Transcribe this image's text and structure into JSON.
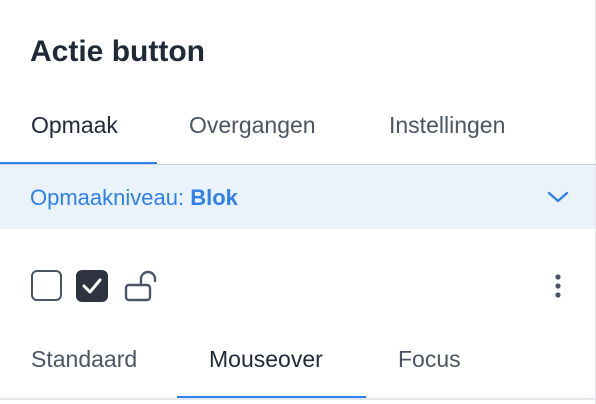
{
  "panel": {
    "title": "Actie button"
  },
  "main_tabs": {
    "items": [
      {
        "label": "Opmaak",
        "active": true
      },
      {
        "label": "Overgangen",
        "active": false
      },
      {
        "label": "Instellingen",
        "active": false
      }
    ]
  },
  "style_level": {
    "label": "Opmaakniveau:",
    "value": "Blok",
    "icon": "chevron-down-icon"
  },
  "toolbar": {
    "unchecked_box": {
      "checked": false
    },
    "checked_box": {
      "checked": true,
      "icon": "check-icon"
    },
    "lock_icon": "unlocked-lock-icon",
    "more_icon": "more-vertical-icon"
  },
  "state_tabs": {
    "items": [
      {
        "label": "Standaard",
        "active": false
      },
      {
        "label": "Mouseover",
        "active": true
      },
      {
        "label": "Focus",
        "active": false
      }
    ]
  },
  "colors": {
    "accent": "#2f80ed",
    "level_bar_bg": "#eaf3fc",
    "text_dark": "#1f2937",
    "text_muted": "#4b5563",
    "checkbox_dark": "#2d3440"
  }
}
